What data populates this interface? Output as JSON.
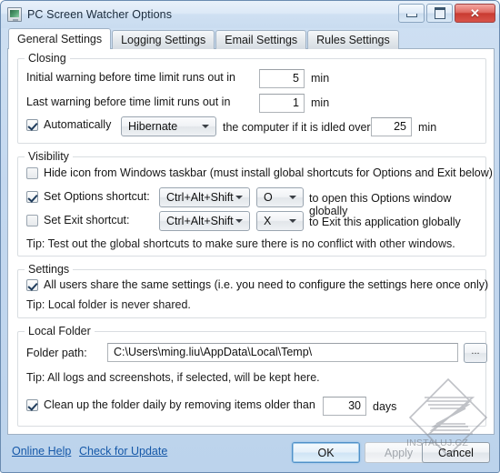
{
  "window": {
    "title": "PC Screen Watcher Options",
    "icon": "screen-monitor-icon",
    "buttons": {
      "minimize": "minimize-icon",
      "maximize": "maximize-icon",
      "close": "✕"
    }
  },
  "tabs": [
    {
      "label": "General Settings",
      "active": true
    },
    {
      "label": "Logging Settings",
      "active": false
    },
    {
      "label": "Email Settings",
      "active": false
    },
    {
      "label": "Rules Settings",
      "active": false
    }
  ],
  "groups": {
    "closing": {
      "legend": "Closing",
      "initial_warning_label": "Initial warning before time limit runs out in",
      "initial_warning_value": "5",
      "initial_warning_unit": "min",
      "last_warning_label": "Last warning before time limit runs out in",
      "last_warning_value": "1",
      "last_warning_unit": "min",
      "automatically_checked": true,
      "automatically_label": "Automatically",
      "action_value": "Hibernate",
      "idle_label": "the computer if it is idled over",
      "idle_value": "25",
      "idle_unit": "min"
    },
    "visibility": {
      "legend": "Visibility",
      "hide_icon_checked": false,
      "hide_icon_label": "Hide icon from Windows taskbar (must install global shortcuts for Options and Exit below)",
      "options_shortcut_checked": true,
      "options_shortcut_label": "Set Options shortcut:",
      "options_modifier": "Ctrl+Alt+Shift",
      "options_key": "O",
      "options_suffix": "to open this Options window globally",
      "exit_shortcut_checked": false,
      "exit_shortcut_label": "Set Exit shortcut:",
      "exit_modifier": "Ctrl+Alt+Shift",
      "exit_key": "X",
      "exit_suffix": "to Exit this application globally",
      "tip": "Tip: Test out the global shortcuts to make sure there is no conflict with other windows."
    },
    "settings": {
      "legend": "Settings",
      "share_checked": true,
      "share_label": "All users share the same settings (i.e. you need to configure the settings here once only)",
      "tip": "Tip: Local folder is never shared."
    },
    "local_folder": {
      "legend": "Local Folder",
      "path_label": "Folder path:",
      "path_value": "C:\\Users\\ming.liu\\AppData\\Local\\Temp\\",
      "browse_label": "...",
      "tip": "Tip: All logs and screenshots, if selected, will be kept here.",
      "cleanup_checked": true,
      "cleanup_label": "Clean up the folder daily by removing items older than",
      "cleanup_value": "30",
      "cleanup_unit": "days"
    }
  },
  "footer": {
    "online_help": "Online Help",
    "check_update": "Check for Update",
    "ok": "OK",
    "apply": "Apply",
    "cancel": "Cancel"
  },
  "watermark": {
    "text": "INSTALUJ.CZ"
  },
  "colors": {
    "accent": "#1558a8",
    "close_button": "#c93b31",
    "window_frame": "#bcd3ec"
  }
}
